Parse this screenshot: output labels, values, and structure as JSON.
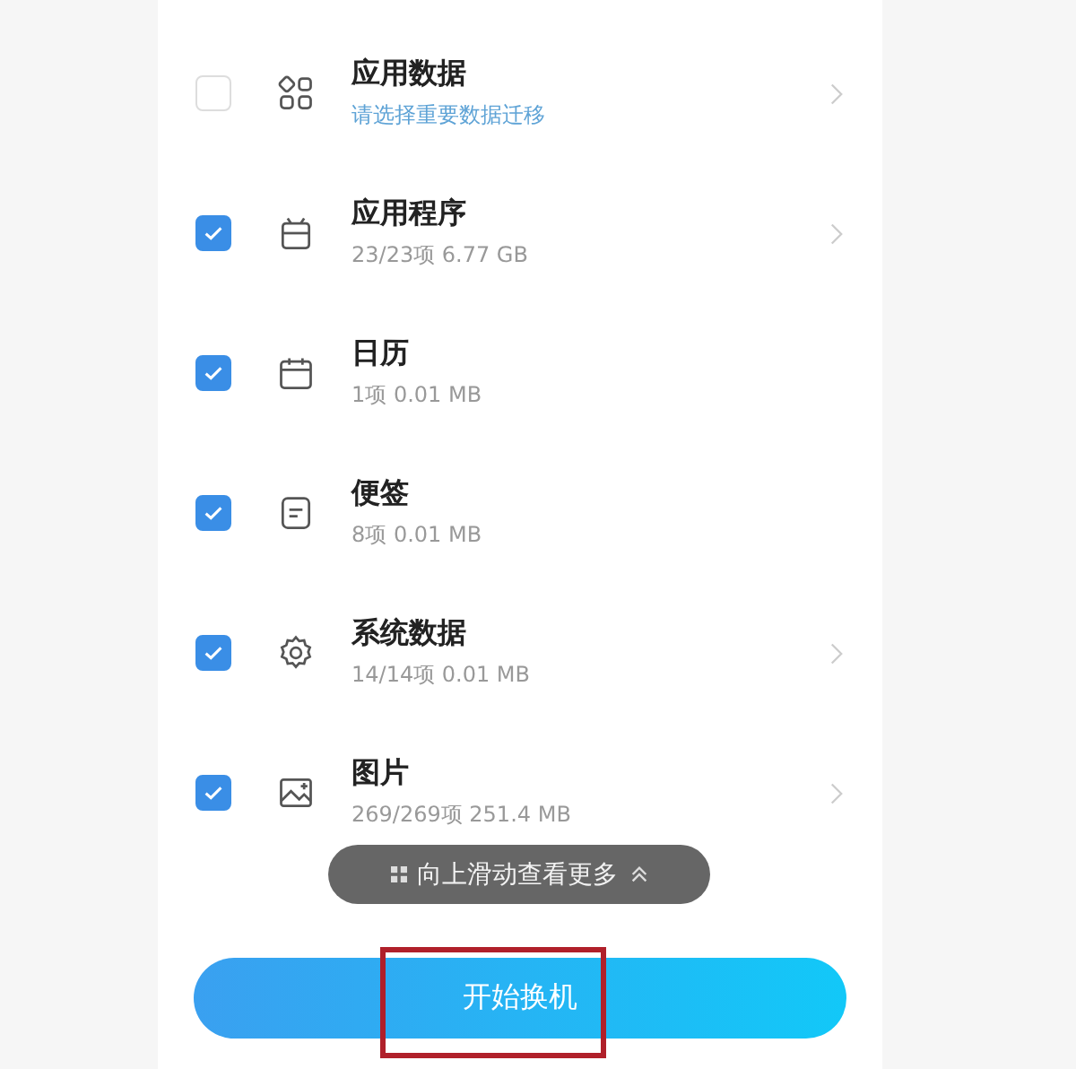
{
  "items": [
    {
      "title": "应用数据",
      "subtitle": "请选择重要数据迁移",
      "subtitle_hint": true,
      "checked": false,
      "expandable": true
    },
    {
      "title": "应用程序",
      "subtitle": "23/23项  6.77 GB",
      "subtitle_hint": false,
      "checked": true,
      "expandable": true
    },
    {
      "title": "日历",
      "subtitle": "1项  0.01 MB",
      "subtitle_hint": false,
      "checked": true,
      "expandable": false
    },
    {
      "title": "便签",
      "subtitle": "8项  0.01 MB",
      "subtitle_hint": false,
      "checked": true,
      "expandable": false
    },
    {
      "title": "系统数据",
      "subtitle": "14/14项  0.01 MB",
      "subtitle_hint": false,
      "checked": true,
      "expandable": true
    },
    {
      "title": "图片",
      "subtitle": "269/269项  251.4 MB",
      "subtitle_hint": false,
      "checked": true,
      "expandable": true
    }
  ],
  "toast": {
    "text": "向上滑动查看更多"
  },
  "start_button": {
    "label": "开始换机",
    "highlighted": true
  }
}
